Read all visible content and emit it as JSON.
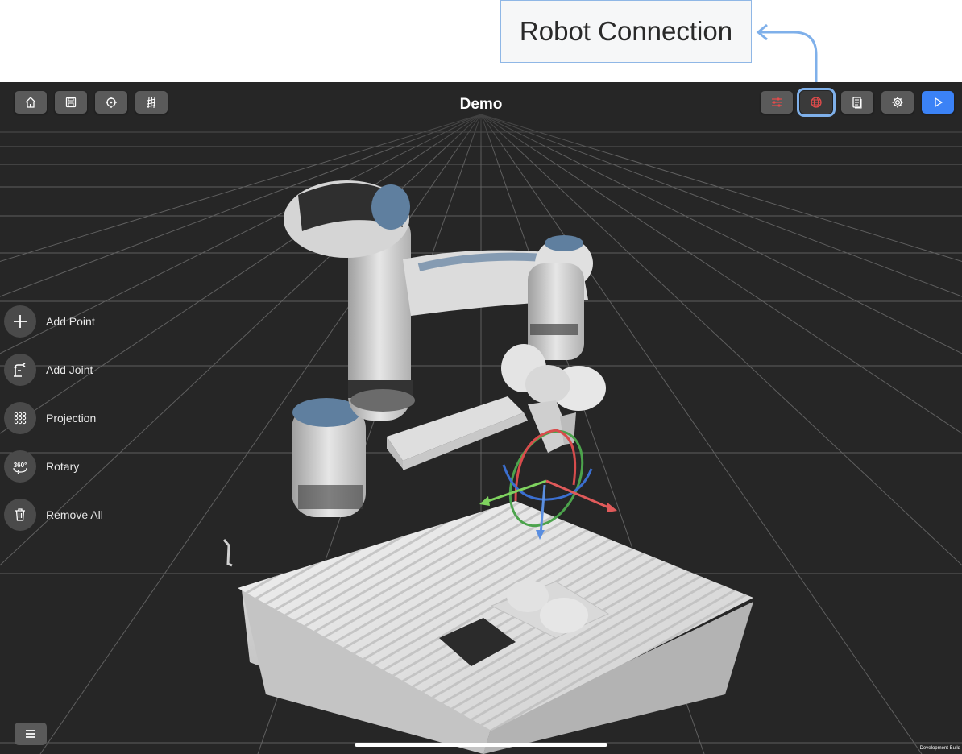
{
  "callout": {
    "label": "Robot Connection"
  },
  "app": {
    "title": "Demo"
  },
  "toolbar_left": [
    {
      "name": "home-button",
      "icon": "home-icon"
    },
    {
      "name": "save-button",
      "icon": "save-icon"
    },
    {
      "name": "target-button",
      "icon": "crosshair-icon"
    },
    {
      "name": "grid-button",
      "icon": "grid-icon"
    }
  ],
  "toolbar_right": [
    {
      "name": "sliders-button",
      "icon": "sliders-icon",
      "color": "#e14b4b"
    },
    {
      "name": "robot-connection-button",
      "icon": "globe-icon",
      "color": "#e14b4b",
      "highlighted": true
    },
    {
      "name": "document-button",
      "icon": "document-icon"
    },
    {
      "name": "settings-button",
      "icon": "gear-icon"
    },
    {
      "name": "play-button",
      "icon": "play-icon",
      "color": "#3b82f6"
    }
  ],
  "side_tools": [
    {
      "label": "Add Point",
      "icon": "plus-icon"
    },
    {
      "label": "Add Joint",
      "icon": "robot-arm-icon"
    },
    {
      "label": "Projection",
      "icon": "dots-grid-icon"
    },
    {
      "label": "Rotary",
      "icon": "rotate-360-icon",
      "icon_text": "360°"
    },
    {
      "label": "Remove All",
      "icon": "trash-icon"
    }
  ],
  "footer": {
    "build_label": "Development Build"
  },
  "colors": {
    "viewport_bg": "#262626",
    "button_bg": "#5a5a5a",
    "accent": "#3b82f6",
    "callout_border": "#8fb7e6"
  }
}
